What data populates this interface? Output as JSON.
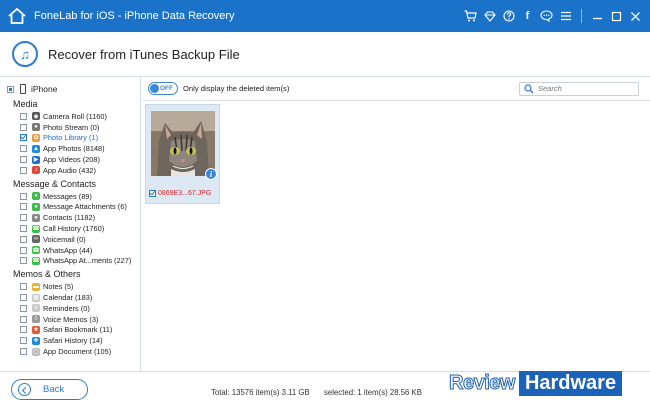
{
  "window": {
    "title": "FoneLab for iOS - iPhone Data Recovery"
  },
  "header": {
    "title": "Recover from iTunes Backup File"
  },
  "sidebar": {
    "device": "iPhone",
    "groups": [
      {
        "label": "Media",
        "items": [
          {
            "label": "Camera Roll (1160)",
            "icon": "camera-icon",
            "checked": false
          },
          {
            "label": "Photo Stream (0)",
            "icon": "photo-stream-icon",
            "checked": false
          },
          {
            "label": "Photo Library (1)",
            "icon": "photo-library-icon",
            "checked": true
          },
          {
            "label": "App Photos (8148)",
            "icon": "app-photos-icon",
            "checked": false
          },
          {
            "label": "App Videos (208)",
            "icon": "app-videos-icon",
            "checked": false
          },
          {
            "label": "App Audio (432)",
            "icon": "app-audio-icon",
            "checked": false
          }
        ]
      },
      {
        "label": "Message & Contacts",
        "items": [
          {
            "label": "Messages (89)",
            "icon": "messages-icon",
            "checked": false
          },
          {
            "label": "Message Attachments (6)",
            "icon": "message-attachments-icon",
            "checked": false
          },
          {
            "label": "Contacts (1182)",
            "icon": "contacts-icon",
            "checked": false
          },
          {
            "label": "Call History (1760)",
            "icon": "call-history-icon",
            "checked": false
          },
          {
            "label": "Voicemail (0)",
            "icon": "voicemail-icon",
            "checked": false
          },
          {
            "label": "WhatsApp (44)",
            "icon": "whatsapp-icon",
            "checked": false
          },
          {
            "label": "WhatsApp At...ments (227)",
            "icon": "whatsapp-attachments-icon",
            "checked": false
          }
        ]
      },
      {
        "label": "Memos & Others",
        "items": [
          {
            "label": "Notes (5)",
            "icon": "notes-icon",
            "checked": false
          },
          {
            "label": "Calendar (183)",
            "icon": "calendar-icon",
            "checked": false
          },
          {
            "label": "Reminders (0)",
            "icon": "reminders-icon",
            "checked": false
          },
          {
            "label": "Voice Memos (3)",
            "icon": "voice-memos-icon",
            "checked": false
          },
          {
            "label": "Safari Bookmark (11)",
            "icon": "safari-bookmark-icon",
            "checked": false
          },
          {
            "label": "Safari History (14)",
            "icon": "safari-history-icon",
            "checked": false
          },
          {
            "label": "App Document (105)",
            "icon": "app-document-icon",
            "checked": false
          }
        ]
      }
    ]
  },
  "toolbar": {
    "toggle_state": "OFF",
    "only_deleted_label": "Only display the deleted item(s)",
    "search_placeholder": "Search"
  },
  "content": {
    "files": [
      {
        "name": "0869E3...67.JPG",
        "checked": true
      }
    ]
  },
  "footer": {
    "back_label": "Back",
    "total": "Total: 13576 item(s) 3.11 GB",
    "selected": "selected: 1 item(s) 28.56 KB"
  },
  "watermark": {
    "part1": "Review",
    "part2": "Hardware"
  },
  "colors": {
    "titlebar": "#1a73c8",
    "accent": "#2f7ad1",
    "selected_text": "#1c6ec9",
    "filename": "#d12b2b"
  }
}
